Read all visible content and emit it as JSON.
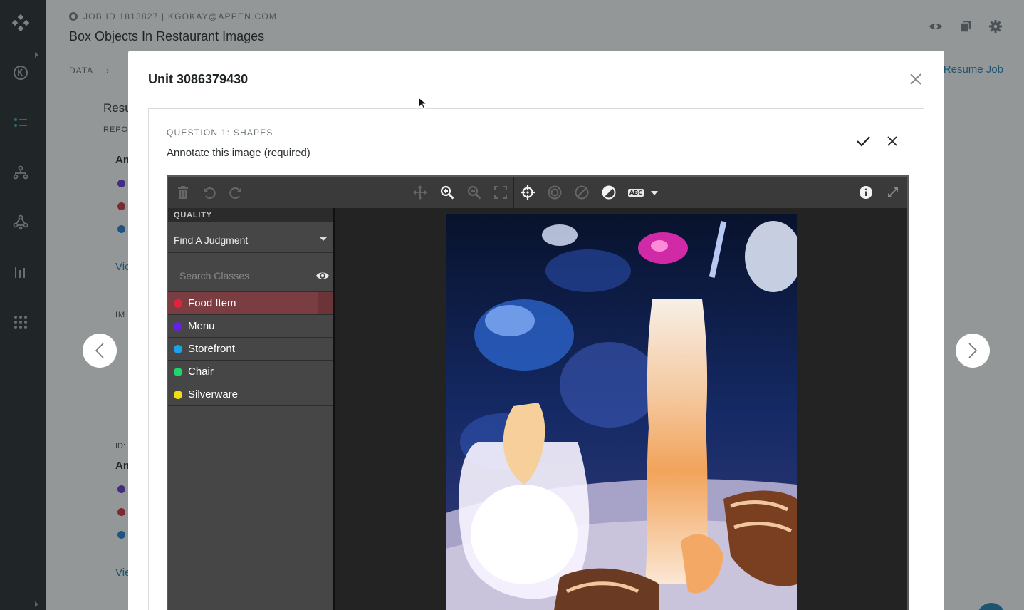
{
  "header": {
    "job_line": "JOB ID 1813827 | KGOKAY@APPEN.COM",
    "title": "Box Objects In Restaurant Images",
    "breadcrumb_first": "DATA",
    "resume_label": "Resume Job"
  },
  "background": {
    "results_heading": "Resu",
    "report_label": "REPO",
    "an_label_1": "An",
    "view_link_1": "Vie",
    "im_label": "IM",
    "id_label": "ID:",
    "an_label_2": "An",
    "view_link_2": "Vie"
  },
  "modal": {
    "title": "Unit 3086379430",
    "question_label": "QUESTION 1: SHAPES",
    "question_text": "Annotate this image (required)"
  },
  "tool": {
    "panel_header": "QUALITY",
    "judgment_select": "Find A Judgment",
    "search_placeholder": "Search Classes",
    "abc_label": "ABC",
    "classes": [
      {
        "label": "Food Item",
        "color": "#e8213b"
      },
      {
        "label": "Menu",
        "color": "#6a1fe6"
      },
      {
        "label": "Storefront",
        "color": "#1aa3e8"
      },
      {
        "label": "Chair",
        "color": "#21d46a"
      },
      {
        "label": "Silverware",
        "color": "#f2e10f"
      }
    ]
  },
  "colors": {
    "nav_bg": "#2d3234",
    "link": "#2a86b6",
    "active_class_row": "#7a3d42"
  }
}
